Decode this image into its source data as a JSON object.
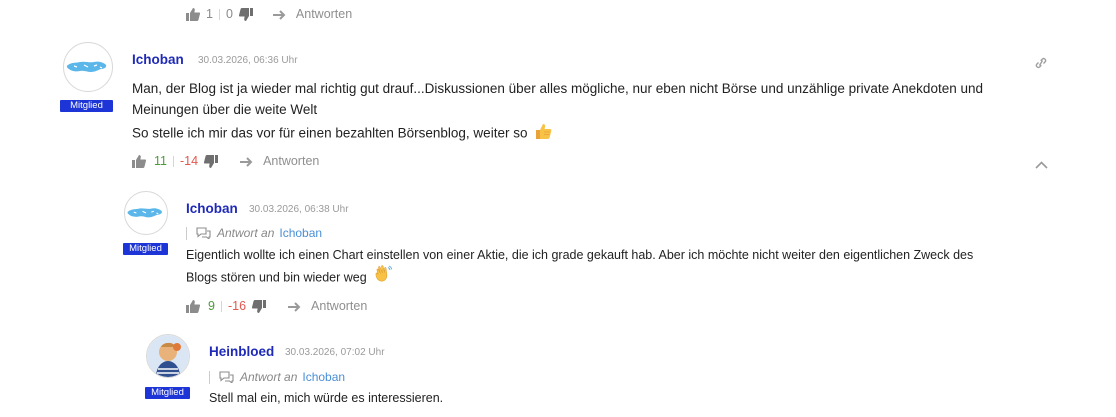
{
  "top_comment": {
    "likes": "1",
    "dislikes": "0",
    "reply_label": "Antworten"
  },
  "comment1": {
    "username": "Ichoban",
    "date": "30.03.2026, 06:36 Uhr",
    "badge": "Mitglied",
    "text_line1": "Man, der Blog ist ja wieder mal richtig gut drauf...Diskussionen über alles mögliche, nur eben nicht Börse und unzählige private Anekdoten und",
    "text_line2": "Meinungen über die weite Welt",
    "text_line3": "So stelle ich mir das vor für einen bezahlten Börsenblog, weiter so",
    "likes": "11",
    "dislikes": "-14",
    "reply_label": "Antworten"
  },
  "comment2": {
    "username": "Ichoban",
    "date": "30.03.2026, 06:38 Uhr",
    "badge": "Mitglied",
    "answer_prefix": "Antwort an",
    "answer_target": "Ichoban",
    "text_line1": "Eigentlich wollte ich einen Chart einstellen von einer Aktie, die ich grade gekauft hab. Aber ich möchte nicht weiter den eigentlichen Zweck des",
    "text_line2": "Blogs stören und bin wieder weg",
    "likes": "9",
    "dislikes": "-16",
    "reply_label": "Antworten"
  },
  "comment3": {
    "username": "Heinbloed",
    "date": "30.03.2026, 07:02 Uhr",
    "badge": "Mitglied",
    "answer_prefix": "Antwort an",
    "answer_target": "Ichoban",
    "text_line1": "Stell mal ein, mich würde es interessieren."
  },
  "colors": {
    "username": "#1f2ab8",
    "badge_bg": "#1d34d6",
    "likes": "#4d9a3a",
    "dislikes": "#e0584f",
    "link": "#4a8fd6"
  }
}
